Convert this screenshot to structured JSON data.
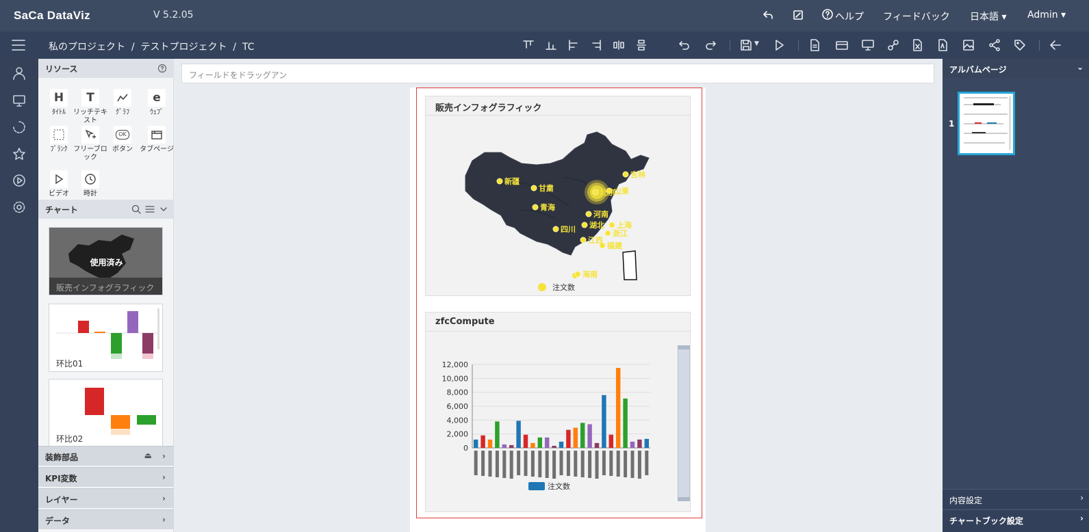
{
  "app": {
    "logo": "SaCa DataViz",
    "version": "V 5.2.05"
  },
  "topbar": {
    "help": "ヘルプ",
    "feedback": "フィードバック",
    "language": "日本語 ▾",
    "user": "Admin ▾"
  },
  "breadcrumb": "私のプロジェクト  /  テストプロジェクト  /  TC",
  "field_drop_placeholder": "フィールドをドラッグアン",
  "resources": {
    "title": "リソース",
    "items": [
      {
        "icon": "H",
        "label": "ﾀｲﾄﾙ"
      },
      {
        "icon": "T",
        "label": "リッチテキスト"
      },
      {
        "icon": "chart-line",
        "label": "ｸﾞﾗﾌ"
      },
      {
        "icon": "e",
        "label": "ｳｪﾌﾞ"
      },
      {
        "icon": "dashed-box",
        "label": "ﾌﾞﾗﾝｸ"
      },
      {
        "icon": "pen-plus",
        "label": "フリーブロック"
      },
      {
        "icon": "OK",
        "label": "ボタン"
      },
      {
        "icon": "tab",
        "label": "タブページ"
      },
      {
        "icon": "play",
        "label": "ビデオ"
      },
      {
        "icon": "clock",
        "label": "時計"
      }
    ]
  },
  "charts_panel": {
    "title": "チャート",
    "thumbs": [
      {
        "label": "販売インフォグラフィック",
        "badge": "使用済み"
      },
      {
        "label": "环比01"
      },
      {
        "label": "环比02"
      }
    ]
  },
  "sections": [
    "装飾部品",
    "KPI変数",
    "レイヤー",
    "データ"
  ],
  "map_card": {
    "title": "販売インフォグラフィック",
    "legend": "注文数",
    "provinces": [
      "新疆",
      "甘粛",
      "青海",
      "四川",
      "河南",
      "湖北",
      "上海",
      "浙江",
      "福建",
      "海南",
      "江西",
      "吉林",
      "山東",
      "北京"
    ]
  },
  "bar_card": {
    "title": "zfcCompute",
    "legend": "注文数"
  },
  "right": {
    "album": "アルバムページ",
    "page_number": "1",
    "content_settings": "内容設定",
    "chartbook_settings": "チャートブック設定"
  },
  "chart_data": {
    "type": "bar",
    "title": "zfcCompute",
    "series": [
      {
        "name": "注文数",
        "values": [
          1200,
          1800,
          1200,
          3800,
          500,
          400,
          3900,
          1900,
          700,
          1500,
          1500,
          300,
          900,
          2600,
          2900,
          3600,
          3400,
          700,
          7600,
          1900,
          11500,
          7100,
          900,
          1200,
          1300
        ]
      }
    ],
    "categories": [
      "",
      "",
      "",
      "",
      "",
      "",
      "",
      "",
      "",
      "",
      "",
      "",
      "",
      "",
      "",
      "",
      "",
      "",
      "",
      "",
      "",
      "",
      "",
      "",
      ""
    ],
    "yticks": [
      "0",
      "2,000",
      "4,000",
      "6,000",
      "8,000",
      "10,000",
      "12,000"
    ],
    "ylim": [
      0,
      12000
    ],
    "colors": [
      "#1f77b4",
      "#d62728",
      "#ff7f0e",
      "#2ca02c",
      "#9467bd",
      "#8c3b65"
    ]
  }
}
